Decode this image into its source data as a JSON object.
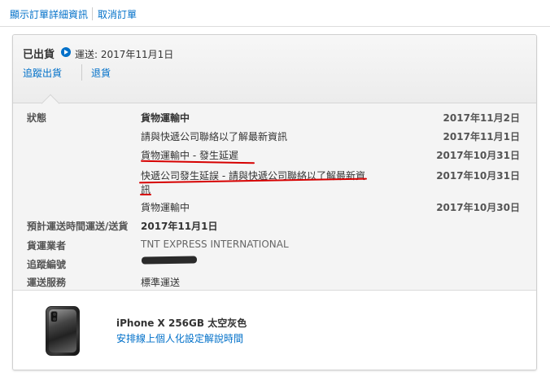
{
  "top_links": {
    "show_details": "顯示訂單詳細資訊",
    "cancel_order": "取消訂單"
  },
  "shipment": {
    "status": "已出貨",
    "ship_label": "運送: 2017年11月1日",
    "track_link": "追蹤出貨",
    "return_link": "退貨"
  },
  "details": {
    "status_label": "狀態",
    "events": [
      {
        "text": "貨物運輸中",
        "date": "2017年11月2日"
      },
      {
        "text": "請與快遞公司聯絡以了解最新資訊",
        "date": "2017年11月1日"
      },
      {
        "text": "貨物運輸中 - 發生延遲",
        "date": "2017年10月31日"
      },
      {
        "text_line1": "快遞公司發生延誤 - 請與快遞公司聯絡以了解最新資",
        "text_line2": "訊",
        "date": "2017年10月31日"
      },
      {
        "text": "貨物運輸中",
        "date": "2017年10月30日"
      }
    ],
    "eta_label": "預計運送時間運送/送貨",
    "eta_value": "2017年11月1日",
    "carrier_label": "貨運業者",
    "carrier_value": "TNT EXPRESS INTERNATIONAL",
    "tracking_label": "追蹤編號",
    "service_label": "運送服務",
    "service_value": "標準運送"
  },
  "product": {
    "name": "iPhone X 256GB 太空灰色",
    "setup_link": "安排線上個人化設定解說時間"
  },
  "colors": {
    "link": "#0070c9",
    "annotation": "#d60000"
  }
}
